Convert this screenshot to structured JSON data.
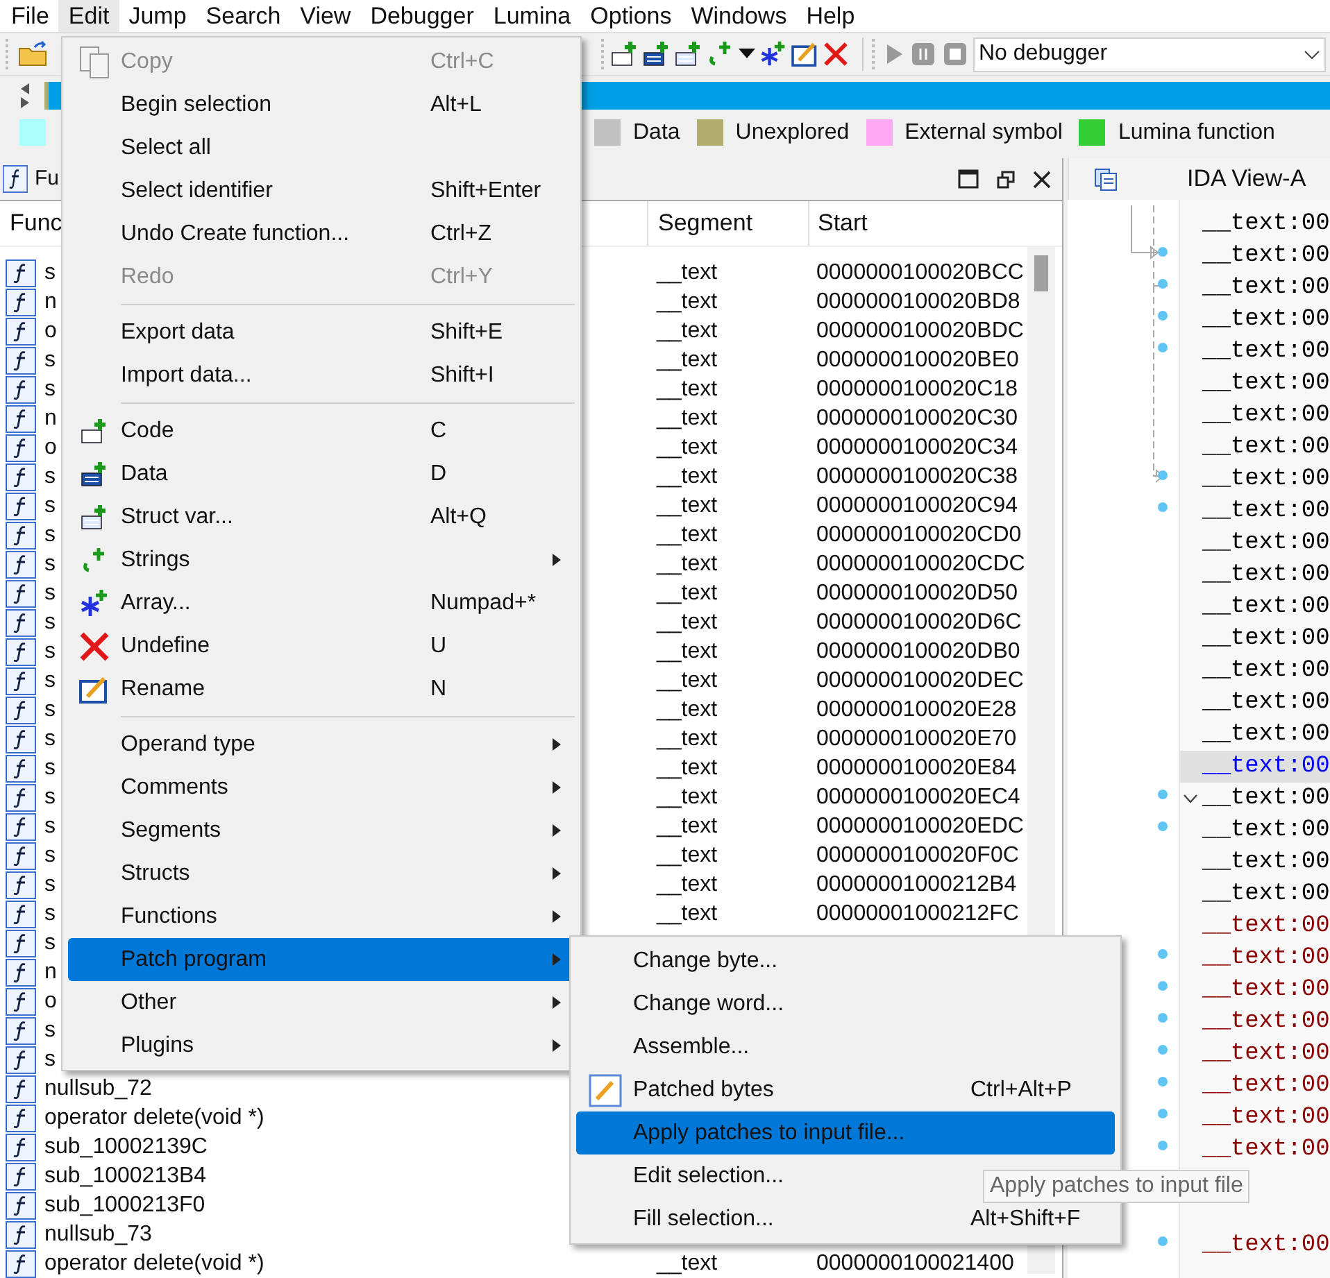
{
  "menubar": [
    {
      "label": "File",
      "selected": false
    },
    {
      "label": "Edit",
      "selected": true
    },
    {
      "label": "Jump",
      "selected": false
    },
    {
      "label": "Search",
      "selected": false
    },
    {
      "label": "View",
      "selected": false
    },
    {
      "label": "Debugger",
      "selected": false
    },
    {
      "label": "Lumina",
      "selected": false
    },
    {
      "label": "Options",
      "selected": false
    },
    {
      "label": "Windows",
      "selected": false
    },
    {
      "label": "Help",
      "selected": false
    }
  ],
  "debugger_select": {
    "value": "No debugger"
  },
  "legend": [
    {
      "color": "#aaffff"
    },
    {
      "label": "Data",
      "color": "#c0c0c0"
    },
    {
      "label": "Unexplored",
      "color": "#b0ad6c"
    },
    {
      "label": "External symbol",
      "color": "#ffa8f4"
    },
    {
      "label": "Lumina function",
      "color": "#33cc33"
    }
  ],
  "functions_panel": {
    "tab": "Fu",
    "columns": [
      "Func",
      "Segment",
      "Start"
    ],
    "rows": [
      {
        "name": "s",
        "segment": "__text",
        "start": "0000000100020BCC"
      },
      {
        "name": "n",
        "segment": "__text",
        "start": "0000000100020BD8"
      },
      {
        "name": "o",
        "segment": "__text",
        "start": "0000000100020BDC"
      },
      {
        "name": "s",
        "segment": "__text",
        "start": "0000000100020BE0"
      },
      {
        "name": "s",
        "segment": "__text",
        "start": "0000000100020C18"
      },
      {
        "name": "n",
        "segment": "__text",
        "start": "0000000100020C30"
      },
      {
        "name": "o",
        "segment": "__text",
        "start": "0000000100020C34"
      },
      {
        "name": "s",
        "segment": "__text",
        "start": "0000000100020C38"
      },
      {
        "name": "s",
        "segment": "__text",
        "start": "0000000100020C94"
      },
      {
        "name": "s",
        "segment": "__text",
        "start": "0000000100020CD0"
      },
      {
        "name": "s",
        "segment": "__text",
        "start": "0000000100020CDC"
      },
      {
        "name": "s",
        "segment": "__text",
        "start": "0000000100020D50"
      },
      {
        "name": "s",
        "segment": "__text",
        "start": "0000000100020D6C"
      },
      {
        "name": "s",
        "segment": "__text",
        "start": "0000000100020DB0"
      },
      {
        "name": "s",
        "segment": "__text",
        "start": "0000000100020DEC"
      },
      {
        "name": "s",
        "segment": "__text",
        "start": "0000000100020E28"
      },
      {
        "name": "s",
        "segment": "__text",
        "start": "0000000100020E70"
      },
      {
        "name": "s",
        "segment": "__text",
        "start": "0000000100020E84"
      },
      {
        "name": "s",
        "segment": "__text",
        "start": "0000000100020EC4"
      },
      {
        "name": "s",
        "segment": "__text",
        "start": "0000000100020EDC"
      },
      {
        "name": "s",
        "segment": "__text",
        "start": "0000000100020F0C"
      },
      {
        "name": "s",
        "segment": "__text",
        "start": "00000001000212B4"
      },
      {
        "name": "s",
        "segment": "__text",
        "start": "00000001000212FC"
      },
      {
        "name": "s"
      },
      {
        "name": "n"
      },
      {
        "name": "o"
      },
      {
        "name": "s"
      },
      {
        "name": "s"
      },
      {
        "name": "nullsub_72"
      },
      {
        "name": "operator delete(void *)"
      },
      {
        "name": "sub_10002139C"
      },
      {
        "name": "sub_1000213B4"
      },
      {
        "name": "sub_1000213F0"
      },
      {
        "name": "nullsub_73"
      },
      {
        "name": "operator delete(void *)",
        "segment": "__text",
        "start": "0000000100021400"
      }
    ]
  },
  "ida_view": {
    "tab": "IDA View-A",
    "lines": [
      {
        "text": "__text:00",
        "kind": "normal",
        "dot": false,
        "fold": false
      },
      {
        "text": "__text:00",
        "kind": "normal",
        "dot": true,
        "fold": false
      },
      {
        "text": "__text:00",
        "kind": "normal",
        "dot": true,
        "fold": false
      },
      {
        "text": "__text:00",
        "kind": "normal",
        "dot": true,
        "fold": false
      },
      {
        "text": "__text:00",
        "kind": "normal",
        "dot": true,
        "fold": false
      },
      {
        "text": "__text:00",
        "kind": "normal",
        "dot": false,
        "fold": false
      },
      {
        "text": "__text:00",
        "kind": "normal",
        "dot": false,
        "fold": false
      },
      {
        "text": "__text:00",
        "kind": "normal",
        "dot": false,
        "fold": false
      },
      {
        "text": "__text:00",
        "kind": "normal",
        "dot": true,
        "fold": false
      },
      {
        "text": "__text:00",
        "kind": "normal",
        "dot": true,
        "fold": false
      },
      {
        "text": "__text:00",
        "kind": "normal",
        "dot": false,
        "fold": false
      },
      {
        "text": "__text:00",
        "kind": "normal",
        "dot": false,
        "fold": false
      },
      {
        "text": "__text:00",
        "kind": "normal",
        "dot": false,
        "fold": false
      },
      {
        "text": "__text:00",
        "kind": "normal",
        "dot": false,
        "fold": false
      },
      {
        "text": "__text:00",
        "kind": "normal",
        "dot": false,
        "fold": false
      },
      {
        "text": "__text:00",
        "kind": "normal",
        "dot": false,
        "fold": false
      },
      {
        "text": "__text:00",
        "kind": "normal",
        "dot": false,
        "fold": false
      },
      {
        "text": "__text:00",
        "kind": "current",
        "dot": false,
        "fold": false
      },
      {
        "text": "__text:00",
        "kind": "normal",
        "dot": true,
        "fold": true
      },
      {
        "text": "__text:00",
        "kind": "normal",
        "dot": true,
        "fold": false
      },
      {
        "text": "__text:00",
        "kind": "normal",
        "dot": false,
        "fold": false
      },
      {
        "text": "__text:00",
        "kind": "normal",
        "dot": false,
        "fold": false
      },
      {
        "text": "__text:00",
        "kind": "marked",
        "dot": false,
        "fold": false
      },
      {
        "text": "__text:00",
        "kind": "marked",
        "dot": true,
        "fold": false
      },
      {
        "text": "__text:00",
        "kind": "marked",
        "dot": true,
        "fold": false
      },
      {
        "text": "__text:00",
        "kind": "marked",
        "dot": true,
        "fold": false
      },
      {
        "text": "__text:00",
        "kind": "marked",
        "dot": true,
        "fold": false
      },
      {
        "text": "__text:00",
        "kind": "marked",
        "dot": true,
        "fold": false
      },
      {
        "text": "__text:00",
        "kind": "marked",
        "dot": true,
        "fold": false
      },
      {
        "text": "__text:00",
        "kind": "marked",
        "dot": true,
        "fold": false
      },
      {
        "dot": false
      },
      {
        "dot": false
      },
      {
        "text": "__text:00",
        "kind": "marked",
        "dot": true,
        "fold": false
      }
    ]
  },
  "edit_menu": [
    {
      "kind": "item",
      "label": "Copy",
      "shortcut": "Ctrl+C",
      "disabled": true,
      "selected": false
    },
    {
      "kind": "item",
      "label": "Begin selection",
      "shortcut": "Alt+L",
      "disabled": false,
      "selected": false
    },
    {
      "kind": "item",
      "label": "Select all",
      "disabled": false,
      "selected": false
    },
    {
      "kind": "item",
      "label": "Select identifier",
      "shortcut": "Shift+Enter",
      "disabled": false,
      "selected": false
    },
    {
      "kind": "item",
      "label": "Undo Create function...",
      "shortcut": "Ctrl+Z",
      "disabled": false,
      "selected": false
    },
    {
      "kind": "item",
      "label": "Redo",
      "shortcut": "Ctrl+Y",
      "disabled": true,
      "selected": false
    },
    {
      "kind": "separator"
    },
    {
      "kind": "item",
      "label": "Export data",
      "shortcut": "Shift+E",
      "disabled": false,
      "selected": false
    },
    {
      "kind": "item",
      "label": "Import data...",
      "shortcut": "Shift+I",
      "disabled": false,
      "selected": false
    },
    {
      "kind": "separator"
    },
    {
      "kind": "item",
      "label": "Code",
      "shortcut": "C",
      "disabled": false,
      "selected": false
    },
    {
      "kind": "item",
      "label": "Data",
      "shortcut": "D",
      "disabled": false,
      "selected": false
    },
    {
      "kind": "item",
      "label": "Struct var...",
      "shortcut": "Alt+Q",
      "disabled": false,
      "selected": false
    },
    {
      "kind": "submenu",
      "label": "Strings",
      "disabled": false,
      "selected": false
    },
    {
      "kind": "item",
      "label": "Array...",
      "shortcut": "Numpad+*",
      "disabled": false,
      "selected": false
    },
    {
      "kind": "item",
      "label": "Undefine",
      "shortcut": "U",
      "disabled": false,
      "selected": false
    },
    {
      "kind": "item",
      "label": "Rename",
      "shortcut": "N",
      "disabled": false,
      "selected": false
    },
    {
      "kind": "separator"
    },
    {
      "kind": "submenu",
      "label": "Operand type",
      "disabled": false,
      "selected": false
    },
    {
      "kind": "submenu",
      "label": "Comments",
      "disabled": false,
      "selected": false
    },
    {
      "kind": "submenu",
      "label": "Segments",
      "disabled": false,
      "selected": false
    },
    {
      "kind": "submenu",
      "label": "Structs",
      "disabled": false,
      "selected": false
    },
    {
      "kind": "submenu",
      "label": "Functions",
      "disabled": false,
      "selected": false
    },
    {
      "kind": "submenu",
      "label": "Patch program",
      "disabled": false,
      "selected": true
    },
    {
      "kind": "submenu",
      "label": "Other",
      "disabled": false,
      "selected": false
    },
    {
      "kind": "submenu",
      "label": "Plugins",
      "disabled": false,
      "selected": false
    }
  ],
  "patch_submenu": [
    {
      "kind": "item",
      "label": "Change byte...",
      "disabled": false,
      "selected": false
    },
    {
      "kind": "item",
      "label": "Change word...",
      "disabled": false,
      "selected": false
    },
    {
      "kind": "item",
      "label": "Assemble...",
      "disabled": false,
      "selected": false
    },
    {
      "kind": "item",
      "label": "Patched bytes",
      "shortcut": "Ctrl+Alt+P",
      "disabled": false,
      "selected": false
    },
    {
      "kind": "item",
      "label": "Apply patches to input file...",
      "disabled": false,
      "selected": true
    },
    {
      "kind": "item",
      "label": "Edit selection...",
      "disabled": false,
      "selected": false
    },
    {
      "kind": "item",
      "label": "Fill selection...",
      "shortcut": "Alt+Shift+F",
      "disabled": false,
      "selected": false
    }
  ],
  "tooltip": {
    "text": "Apply patches to input file"
  }
}
